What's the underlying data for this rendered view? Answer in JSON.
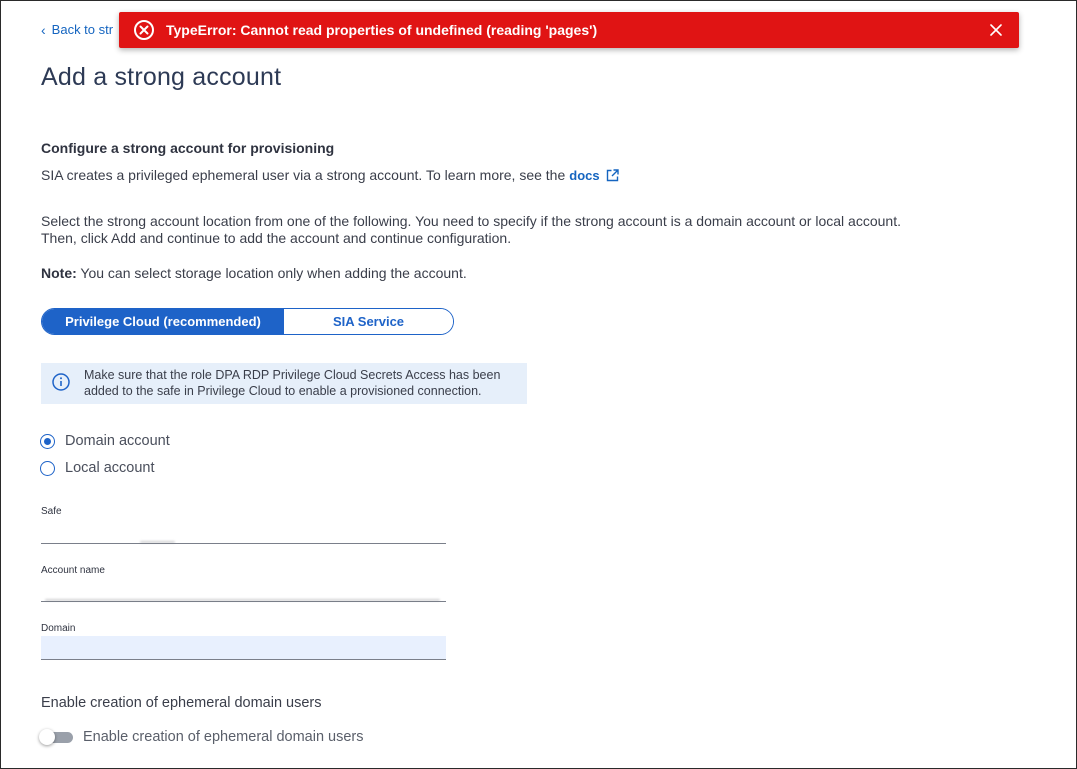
{
  "nav": {
    "back_label": "Back to str"
  },
  "error": {
    "message": "TypeError: Cannot read properties of undefined (reading 'pages')",
    "icon": "error-circle-icon",
    "color": "#e01414"
  },
  "page": {
    "title": "Add a strong account",
    "subtitle": "Configure a strong account for provisioning",
    "description": "SIA creates a privileged ephemeral user via a strong account. To learn more, see the",
    "docs_label": "docs",
    "select_line1": "Select the strong account location from one of the following. You need to specify if the strong account is a domain account or local account.",
    "select_line2": "Then, click Add and continue to add the account and continue configuration.",
    "note_label": "Note:",
    "note_text": "You can select storage location only when adding the account."
  },
  "location_toggle": {
    "options": [
      "Privilege Cloud (recommended)",
      "SIA Service"
    ],
    "selected": "Privilege Cloud (recommended)",
    "accent": "#1e63c8"
  },
  "info": {
    "line1": "Make sure that the role DPA RDP Privilege Cloud Secrets Access has been",
    "line2": "added to the safe in Privilege Cloud to enable a provisioned connection."
  },
  "account_type": {
    "options": [
      "Domain account",
      "Local account"
    ],
    "selected": "Domain account"
  },
  "fields": {
    "safe_label": "Safe",
    "account_name_label": "Account name",
    "domain_label": "Domain"
  },
  "ephemeral": {
    "heading": "Enable creation of ephemeral domain users",
    "toggle_label": "Enable creation of ephemeral domain users",
    "enabled": false
  }
}
